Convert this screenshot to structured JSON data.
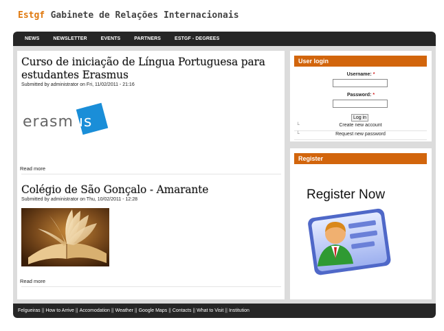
{
  "header": {
    "brand": "Estgf",
    "title": "Gabinete de Relações Internacionais"
  },
  "nav": [
    "NEWS",
    "NEWSLETTER",
    "EVENTS",
    "PARTNERS",
    "ESTGF - DEGREES"
  ],
  "articles": [
    {
      "title": "Curso de iniciação de Língua Portuguesa para estudantes Erasmus",
      "submitted": "Submitted by administrator on Fri, 11/02/2011 - 21:16",
      "image_logo_text": "erasmus",
      "read_more": "Read more"
    },
    {
      "title": "Colégio de São Gonçalo - Amarante",
      "submitted": "Submitted by administrator on Thu, 10/02/2011 - 12:28",
      "read_more": "Read more"
    }
  ],
  "login": {
    "title": "User login",
    "username_label": "Username:",
    "password_label": "Password:",
    "required_mark": "*",
    "username_value": "",
    "password_value": "",
    "button": "Log in",
    "create_account": "Create new account",
    "request_password": "Request new password"
  },
  "register": {
    "title": "Register",
    "banner_text": "Register Now",
    "icon": "user-id-card-icon"
  },
  "footer": [
    "Felgueiras",
    "How to Arrive",
    "Accomodation",
    "Weather",
    "Google Maps",
    "Contacts",
    "What to Visit",
    "Institution"
  ],
  "footer_separator": "||",
  "colors": {
    "brand": "#e07a10",
    "block_title": "#d2650c",
    "bar": "#262626",
    "frame": "#dcdcdc"
  }
}
